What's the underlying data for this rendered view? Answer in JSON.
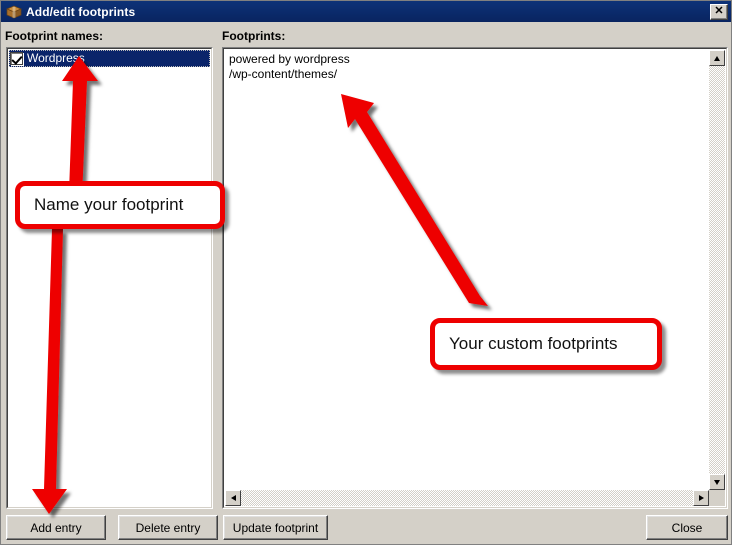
{
  "window": {
    "title": "Add/edit footprints",
    "icon": "package-icon",
    "close_label": "✕",
    "titlebar_color": "#0d3278",
    "background_color": "#d4d0c8"
  },
  "left_panel": {
    "label": "Footprint names:",
    "items": [
      {
        "label": "Wordpress",
        "checked": true,
        "selected": true
      }
    ]
  },
  "right_panel": {
    "label": "Footprints:",
    "lines": [
      "powered by wordpress",
      "/wp-content/themes/"
    ],
    "text": "powered by wordpress\n/wp-content/themes/"
  },
  "scrollbars": {
    "up_arrow": "scroll-up-icon",
    "down_arrow": "scroll-down-icon",
    "left_arrow": "scroll-left-icon",
    "right_arrow": "scroll-right-icon"
  },
  "buttons": {
    "add_entry": "Add entry",
    "delete_entry": "Delete entry",
    "update_footprint": "Update footprint",
    "close": "Close"
  },
  "annotations": {
    "accent_color": "#ee0000",
    "callout_name": "Name your footprint",
    "callout_custom": "Your custom footprints",
    "arrows": [
      {
        "name": "arrow-up-to-list",
        "from": "callout_name",
        "to": "left_panel.items.0"
      },
      {
        "name": "arrow-down-to-add-entry",
        "from": "callout_name",
        "to": "buttons.add_entry"
      },
      {
        "name": "arrow-up-left-to-text",
        "from": "callout_custom",
        "to": "right_panel.text"
      }
    ]
  }
}
